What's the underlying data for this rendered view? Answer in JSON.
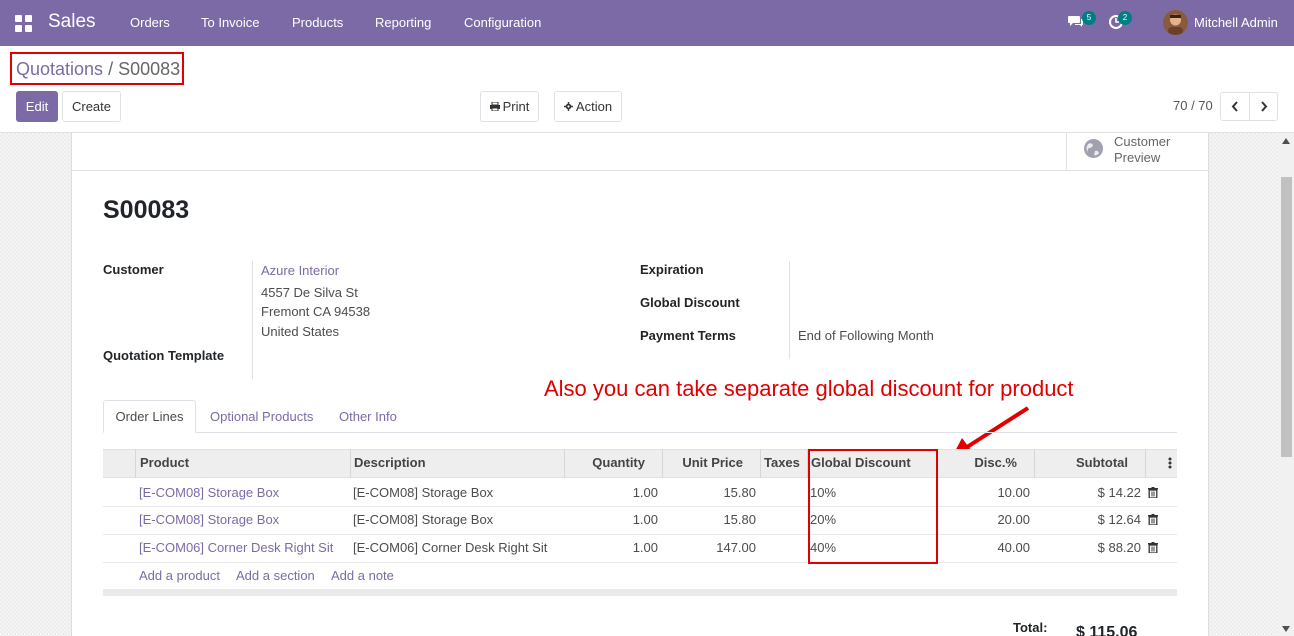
{
  "nav": {
    "brand": "Sales",
    "menu": [
      "Orders",
      "To Invoice",
      "Products",
      "Reporting",
      "Configuration"
    ],
    "messages_count": "5",
    "activities_count": "2",
    "user_name": "Mitchell Admin"
  },
  "control_panel": {
    "breadcrumb_parent": "Quotations",
    "breadcrumb_sep": "/",
    "breadcrumb_current": "S00083",
    "edit_label": "Edit",
    "create_label": "Create",
    "print_label": "Print",
    "action_label": "Action",
    "pager": "70 / 70"
  },
  "status": {
    "customer_preview_label": "Customer Preview"
  },
  "form": {
    "title": "S00083",
    "customer_label": "Customer",
    "customer_name": "Azure Interior",
    "customer_address": [
      "4557 De Silva St",
      "Fremont CA 94538",
      "United States"
    ],
    "quotation_template_label": "Quotation Template",
    "expiration_label": "Expiration",
    "global_discount_label": "Global Discount",
    "payment_terms_label": "Payment Terms",
    "payment_terms_value": "End of Following Month"
  },
  "annotation": "Also you can take separate global discount for product",
  "tabs": [
    "Order Lines",
    "Optional Products",
    "Other Info"
  ],
  "table": {
    "columns": [
      "Product",
      "Description",
      "Quantity",
      "Unit Price",
      "Taxes",
      "Global Discount",
      "Disc.%",
      "Subtotal"
    ],
    "rows": [
      {
        "product": "[E-COM08] Storage Box",
        "description": "[E-COM08] Storage Box",
        "quantity": "1.00",
        "unit_price": "15.80",
        "taxes": "",
        "global_discount": "10%",
        "disc": "10.00",
        "subtotal": "$ 14.22"
      },
      {
        "product": "[E-COM08] Storage Box",
        "description": "[E-COM08] Storage Box",
        "quantity": "1.00",
        "unit_price": "15.80",
        "taxes": "",
        "global_discount": "20%",
        "disc": "20.00",
        "subtotal": "$ 12.64"
      },
      {
        "product": "[E-COM06] Corner Desk Right Sit",
        "description": "[E-COM06] Corner Desk Right Sit",
        "quantity": "1.00",
        "unit_price": "147.00",
        "taxes": "",
        "global_discount": "40%",
        "disc": "40.00",
        "subtotal": "$ 88.20"
      }
    ],
    "add_links": [
      "Add a product",
      "Add a section",
      "Add a note"
    ]
  },
  "totals": {
    "total_label": "Total:",
    "total_value": "$ 115.06"
  },
  "colors": {
    "brand": "#7c6aa6",
    "annotation": "#e00000",
    "badge": "#017e84"
  }
}
